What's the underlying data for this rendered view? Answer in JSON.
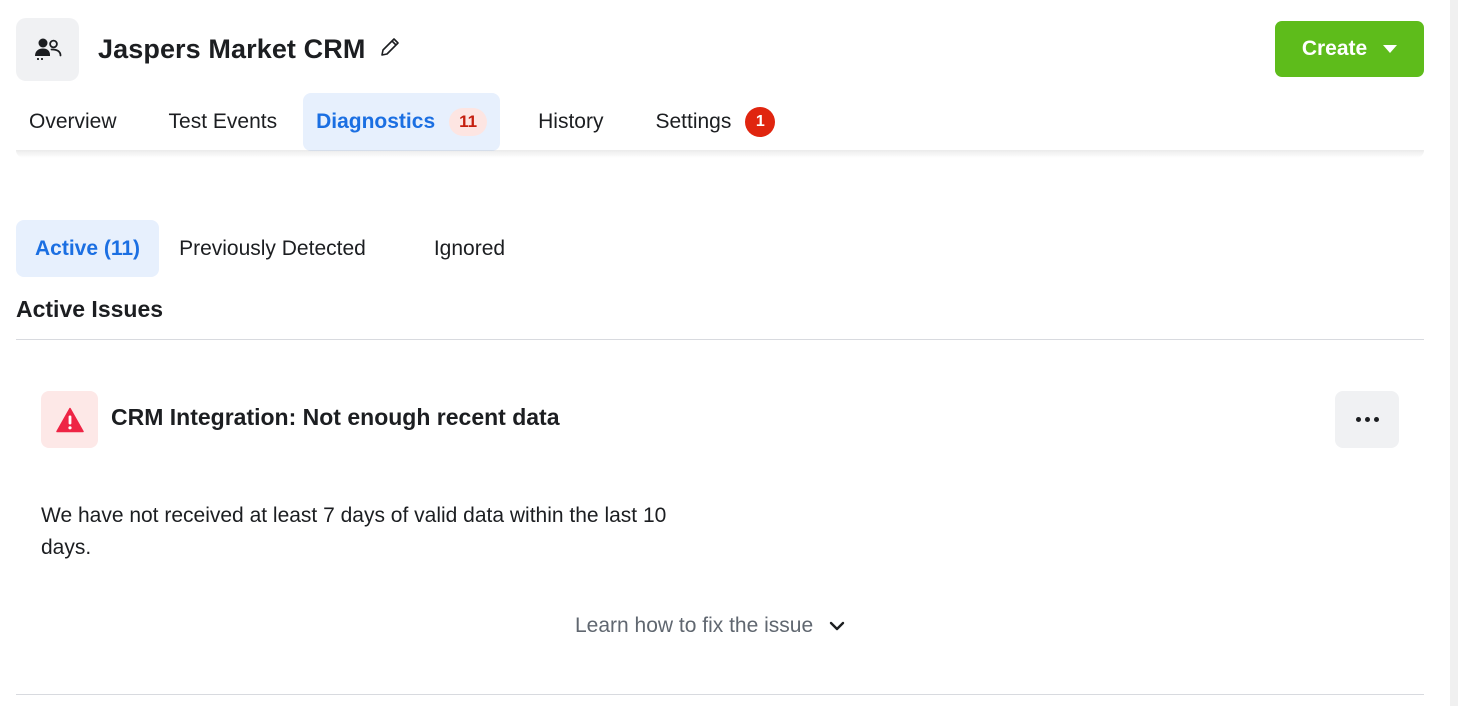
{
  "header": {
    "title": "Jaspers Market CRM",
    "create_label": "Create"
  },
  "top_tabs": [
    {
      "label": "Overview"
    },
    {
      "label": "Test Events"
    },
    {
      "label": "Diagnostics",
      "count": "11",
      "active": true
    },
    {
      "label": "History"
    },
    {
      "label": "Settings",
      "badge": "1"
    }
  ],
  "sub_tabs": [
    {
      "label": "Active (11)",
      "active": true
    },
    {
      "label": "Previously Detected"
    },
    {
      "label": "Ignored"
    }
  ],
  "section": {
    "title": "Active Issues"
  },
  "issue": {
    "title": "CRM Integration: Not enough recent data",
    "description": "We have not received at least 7 days of valid data within the last 10 days.",
    "learn_link": "Learn how to fix the issue"
  },
  "colors": {
    "accent_blue": "#1b6fe2",
    "create_green": "#5ebc1b",
    "alert_red": "#e0250f",
    "warning_icon_red": "#ee2545"
  },
  "icons": {
    "app": "users-icon",
    "edit": "pencil-icon",
    "create_caret": "caret-down-icon",
    "issue": "warning-triangle-icon",
    "more": "more-horizontal-icon",
    "learn": "chevron-down-icon"
  }
}
